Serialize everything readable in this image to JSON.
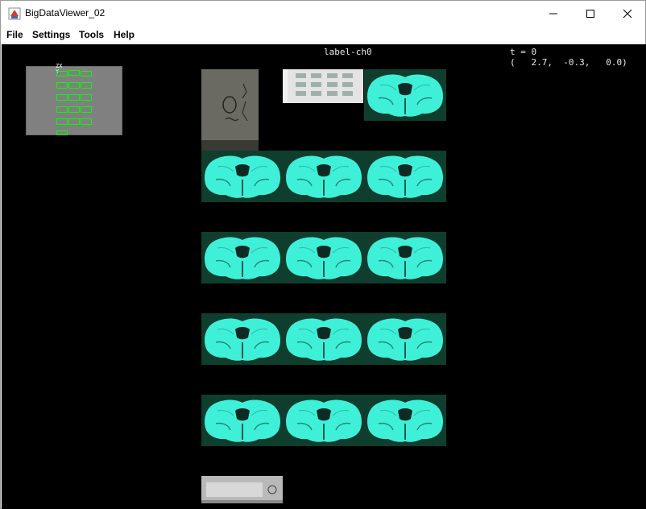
{
  "window": {
    "title": "BigDataViewer_02",
    "icon": "java-cup-icon"
  },
  "titlebar_buttons": {
    "minimize_icon": "minimize-icon",
    "maximize_icon": "maximize-icon",
    "close_icon": "close-icon"
  },
  "menu": {
    "items": [
      "File",
      "Settings",
      "Tools",
      "Help"
    ]
  },
  "viewer": {
    "source_name": "label-ch0",
    "timepoint": "t = 0",
    "coordinates": "(   2.7,  -0.3,   0.0)",
    "colors": {
      "background": "#000000",
      "tissue": "#3ff0d8",
      "slide_bg": "#0f3d2e",
      "navigator_box": "#00ff00"
    }
  },
  "navigator": {
    "axis_label": "ZX\nY"
  }
}
